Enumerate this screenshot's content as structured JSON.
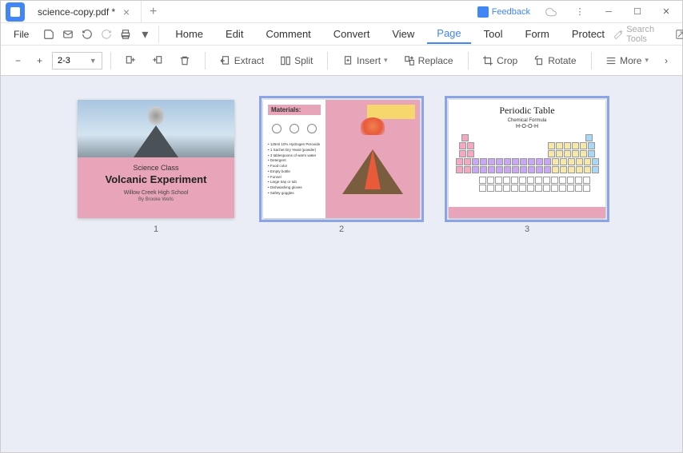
{
  "titlebar": {
    "filename": "science-copy.pdf *",
    "feedback": "Feedback"
  },
  "menu": {
    "file": "File",
    "tabs": [
      "Home",
      "Edit",
      "Comment",
      "Convert",
      "View",
      "Page",
      "Tool",
      "Form",
      "Protect"
    ],
    "active_tab": "Page",
    "search_placeholder": "Search Tools"
  },
  "toolbar": {
    "page_range": "2-3",
    "extract": "Extract",
    "split": "Split",
    "insert": "Insert",
    "replace": "Replace",
    "crop": "Crop",
    "rotate": "Rotate",
    "more": "More"
  },
  "pages": {
    "p1": {
      "num": "1",
      "line1": "Science Class",
      "line2": "Volcanic Experiment",
      "line3": "Willow Creek High School",
      "line4": "By Brooke Wells"
    },
    "p2": {
      "num": "2",
      "materials_label": "Materials:",
      "materials_list": "• 125ml 10% Hydrogen Peroxide\n• 1 Sachet Dry Yeast (powder)\n• 3 tablespoons of warm water\n• Detergent\n• Food color\n• Empty bottle\n• Funnel\n• Large tray or tub\n• Dishwashing gloves\n• Safety goggles"
    },
    "p3": {
      "num": "3",
      "title": "Periodic Table",
      "subtitle": "Chemical Formula",
      "formula": "H-O-O-H"
    }
  }
}
